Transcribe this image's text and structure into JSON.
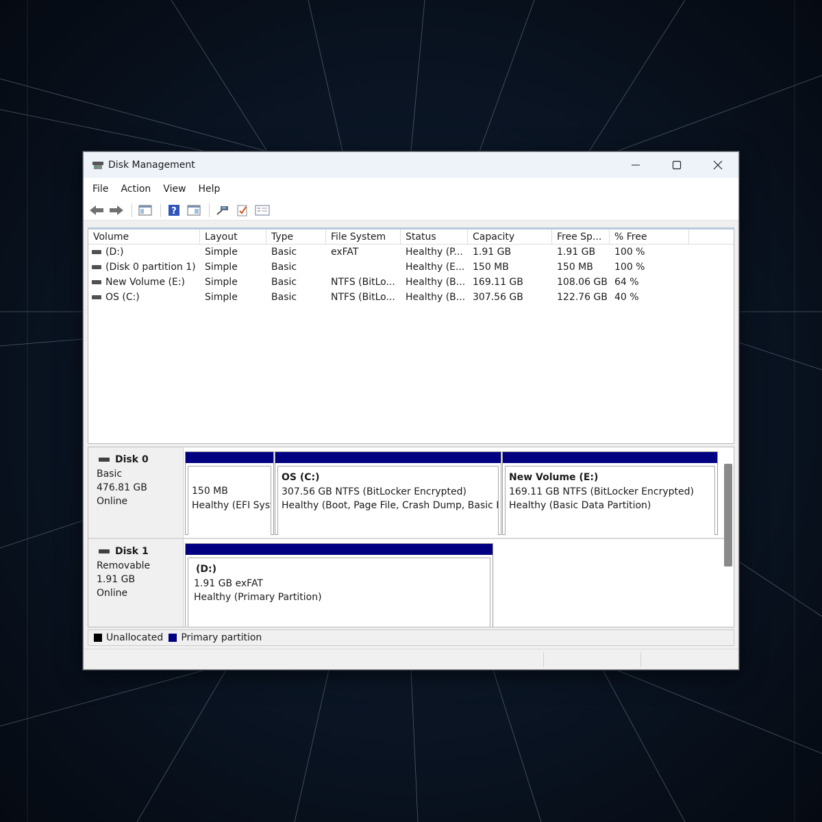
{
  "window": {
    "title": "Disk Management"
  },
  "menu": {
    "file": "File",
    "action": "Action",
    "view": "View",
    "help": "Help"
  },
  "volume_list": {
    "columns": [
      "Volume",
      "Layout",
      "Type",
      "File System",
      "Status",
      "Capacity",
      "Free Sp...",
      "% Free"
    ],
    "rows": [
      {
        "volume": "(D:)",
        "layout": "Simple",
        "type": "Basic",
        "fs": "exFAT",
        "status": "Healthy (P...",
        "capacity": "1.91 GB",
        "free": "1.91 GB",
        "pct": "100 %"
      },
      {
        "volume": "(Disk 0 partition 1)",
        "layout": "Simple",
        "type": "Basic",
        "fs": "",
        "status": "Healthy (E...",
        "capacity": "150 MB",
        "free": "150 MB",
        "pct": "100 %"
      },
      {
        "volume": "New Volume (E:)",
        "layout": "Simple",
        "type": "Basic",
        "fs": "NTFS (BitLo...",
        "status": "Healthy (B...",
        "capacity": "169.11 GB",
        "free": "108.06 GB",
        "pct": "64 %"
      },
      {
        "volume": "OS (C:)",
        "layout": "Simple",
        "type": "Basic",
        "fs": "NTFS (BitLo...",
        "status": "Healthy (B...",
        "capacity": "307.56 GB",
        "free": "122.76 GB",
        "pct": "40 %"
      }
    ]
  },
  "disks": {
    "disk0": {
      "name": "Disk 0",
      "kind": "Basic",
      "size": "476.81 GB",
      "state": "Online",
      "p1": {
        "line1": "150 MB",
        "line2": "Healthy (EFI Syst"
      },
      "p2": {
        "title": "OS  (C:)",
        "line1": "307.56 GB NTFS (BitLocker Encrypted)",
        "line2": "Healthy (Boot, Page File, Crash Dump, Basic D"
      },
      "p3": {
        "title": "New Volume  (E:)",
        "line1": "169.11 GB NTFS (BitLocker Encrypted)",
        "line2": "Healthy (Basic Data Partition)"
      }
    },
    "disk1": {
      "name": "Disk 1",
      "kind": "Removable",
      "size": "1.91 GB",
      "state": "Online",
      "p1": {
        "title": "(D:)",
        "line1": "1.91 GB exFAT",
        "line2": "Healthy (Primary Partition)"
      }
    }
  },
  "legend": {
    "unallocated": "Unallocated",
    "unallocated_color": "#000000",
    "primary": "Primary partition",
    "primary_color": "#000080"
  },
  "icons": [
    "back-icon",
    "forward-icon",
    "console-tree-icon",
    "help-icon",
    "properties-icon",
    "connect-icon",
    "check-icon",
    "settings-list-icon",
    "minimize-icon",
    "maximize-icon",
    "close-icon"
  ]
}
